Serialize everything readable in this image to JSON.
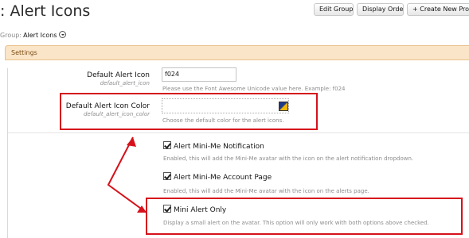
{
  "header": {
    "title": ": Alert Icons",
    "buttons": {
      "edit_group": "Edit Group",
      "display_order": "Display Order",
      "create_new": "+ Create New Prope"
    }
  },
  "group": {
    "label": "Group:",
    "value": "Alert Icons"
  },
  "settings_bar": {
    "label": "Settings"
  },
  "fields": {
    "default_icon": {
      "label": "Default Alert Icon",
      "key": "default_alert_icon",
      "value": "f024",
      "hint": "Please use the Font Awesome Unicode value here. Example: f024"
    },
    "default_icon_color": {
      "label": "Default Alert Icon Color",
      "key": "default_alert_icon_color",
      "hint": "Choose the default color for the alert icons."
    }
  },
  "checkboxes": [
    {
      "label": "Alert Mini-Me Notification",
      "checked": true,
      "hint": "Enabled, this will add the Mini-Me avatar with the icon on the alert notification dropdown."
    },
    {
      "label": "Alert Mini-Me Account Page",
      "checked": true,
      "hint": "Enabled, this will add the Mini-Me avatar with the icon on the alerts page."
    },
    {
      "label": "Mini Alert Only",
      "checked": true,
      "hint": "Display a small alert on the avatar. This option will only work with both options above checked."
    }
  ],
  "colors": {
    "highlight": "#d6111b",
    "settings_bar_bg": "#fbe5c8"
  }
}
